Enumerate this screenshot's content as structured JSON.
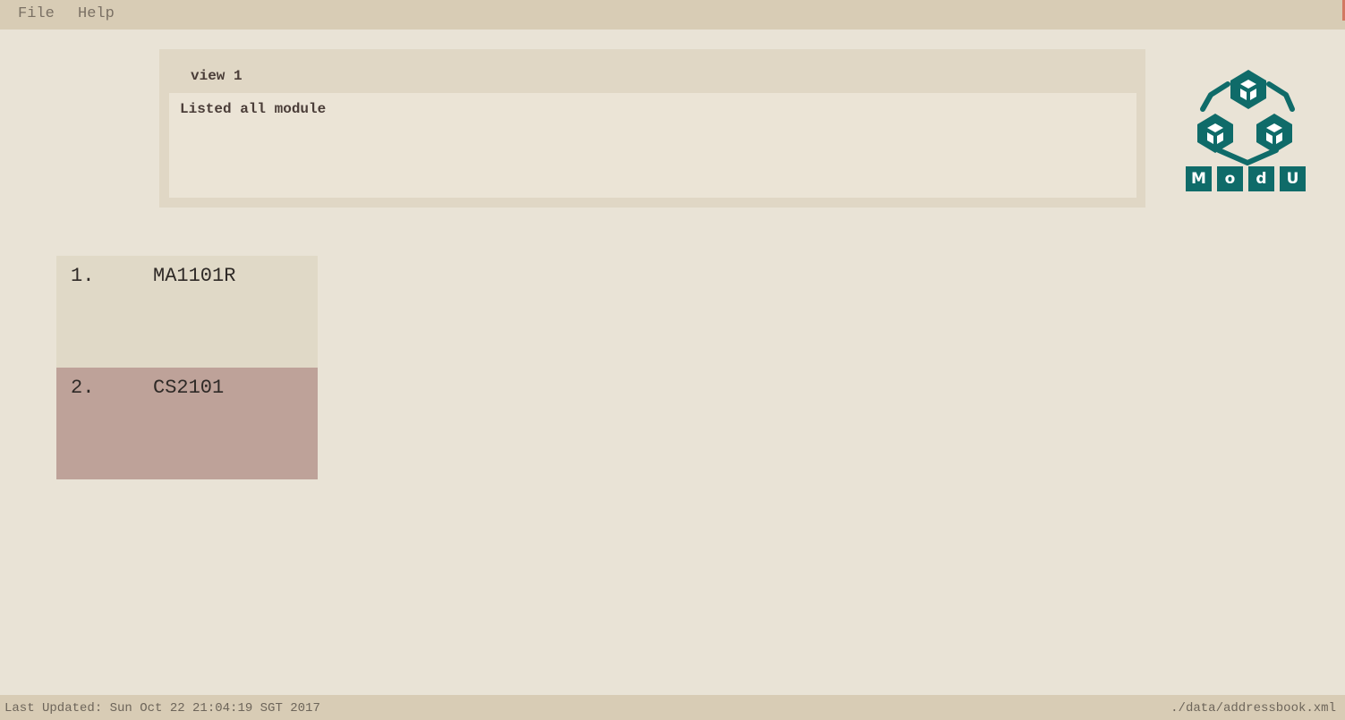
{
  "menu": {
    "file_label": "File",
    "help_label": "Help"
  },
  "command": {
    "input_value": "view 1"
  },
  "result": {
    "message": "Listed all module"
  },
  "logo": {
    "letters": [
      "M",
      "o",
      "d",
      "U"
    ],
    "color": "#0f6b69"
  },
  "modules": [
    {
      "index": "1.",
      "code": "MA1101R"
    },
    {
      "index": "2.",
      "code": "CS2101"
    }
  ],
  "status": {
    "last_updated": "Last Updated: Sun Oct 22 21:04:19 SGT 2017",
    "file_path": "./data/addressbook.xml"
  },
  "colors": {
    "background": "#e9e3d6",
    "bar": "#d8ccb5",
    "card_odd": "#e0d9c7",
    "card_selected": "#bea299",
    "accent": "#0f6b69"
  }
}
